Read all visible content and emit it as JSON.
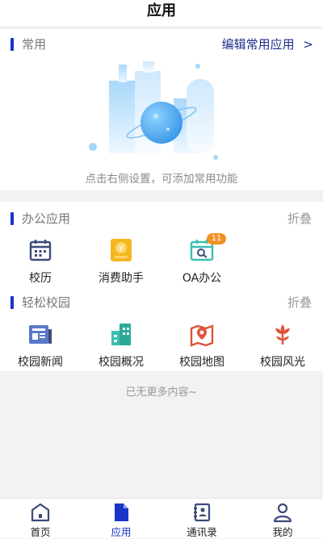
{
  "header": {
    "title": "应用"
  },
  "favorites": {
    "title": "常用",
    "edit_label": "编辑常用应用",
    "edit_arrow": ">",
    "empty_hint": "点击右侧设置，可添加常用功能"
  },
  "office": {
    "title": "办公应用",
    "collapse_label": "折叠",
    "apps": [
      {
        "label": "校历",
        "icon": "calendar-icon"
      },
      {
        "label": "消费助手",
        "icon": "wallet-icon"
      },
      {
        "label": "OA办公",
        "icon": "oa-icon",
        "badge": "11"
      }
    ]
  },
  "campus": {
    "title": "轻松校园",
    "collapse_label": "折叠",
    "apps": [
      {
        "label": "校园新闻",
        "icon": "news-icon"
      },
      {
        "label": "校园概况",
        "icon": "building-icon"
      },
      {
        "label": "校园地图",
        "icon": "map-icon"
      },
      {
        "label": "校园风光",
        "icon": "flower-icon"
      }
    ]
  },
  "footer_hint": "已无更多内容~",
  "tabbar": {
    "tabs": [
      {
        "label": "首页",
        "icon": "home-icon",
        "active": false
      },
      {
        "label": "应用",
        "icon": "apps-doc-icon",
        "active": true
      },
      {
        "label": "通讯录",
        "icon": "contacts-icon",
        "active": false
      },
      {
        "label": "我的",
        "icon": "profile-icon",
        "active": false
      }
    ]
  },
  "colors": {
    "accent": "#1a34c8",
    "badge": "#f29126",
    "icon_blue": "#3b4a7a",
    "icon_yellow": "#f5b720",
    "icon_teal": "#3bbfb0",
    "icon_red": "#e0523a"
  }
}
